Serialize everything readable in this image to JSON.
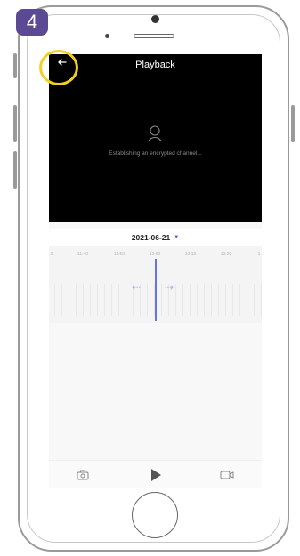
{
  "step_badge": "4",
  "header": {
    "title": "Playback"
  },
  "video": {
    "status": "Establishing an encrypted channel..."
  },
  "date_picker": {
    "date": "2021-06-21",
    "caret": "▼"
  },
  "timeline": {
    "tick_labels": [
      "0",
      "11:40",
      "11:50",
      "12:00",
      "12:10",
      "12:20",
      "1"
    ],
    "arrow_left": "⇠",
    "arrow_right": "⇢"
  },
  "colors": {
    "accent": "#6476d8",
    "badge": "#5b4a93",
    "highlight": "#f2d024",
    "video_bg": "#000000"
  },
  "icons": {
    "back": "arrow-left-icon",
    "person": "person-icon",
    "snapshot": "camera-icon",
    "play": "play-icon",
    "record": "video-record-icon"
  }
}
